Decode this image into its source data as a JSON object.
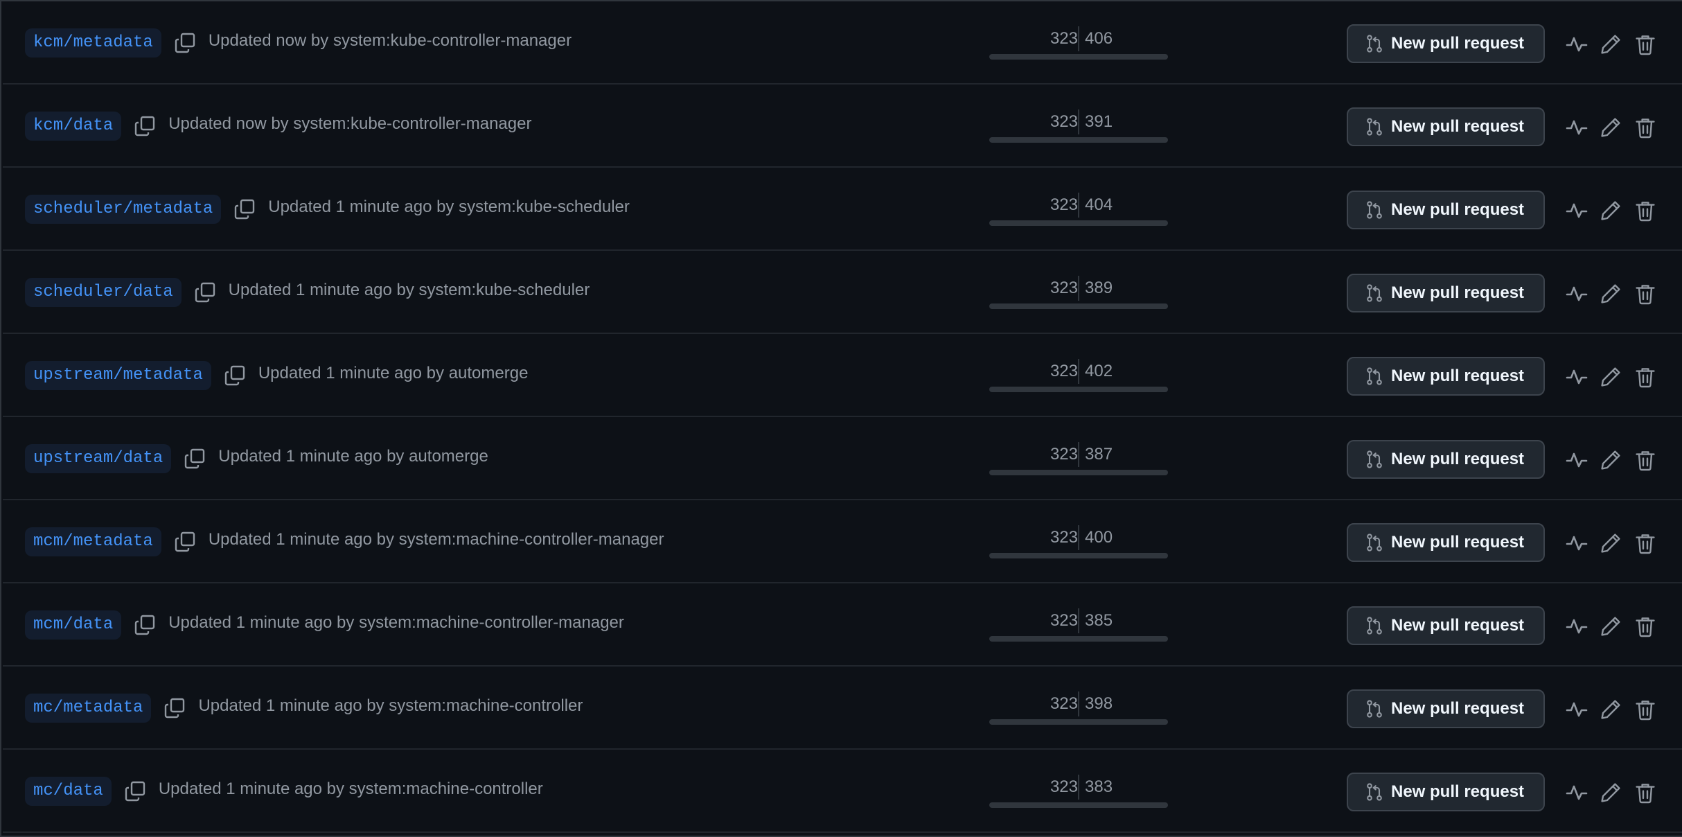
{
  "branches": [
    {
      "name": "kcm/metadata",
      "updated": "Updated now by system:kube-controller-manager",
      "behind": "323",
      "ahead": "406",
      "pr_label": "New pull request"
    },
    {
      "name": "kcm/data",
      "updated": "Updated now by system:kube-controller-manager",
      "behind": "323",
      "ahead": "391",
      "pr_label": "New pull request"
    },
    {
      "name": "scheduler/metadata",
      "updated": "Updated 1 minute ago by system:kube-scheduler",
      "behind": "323",
      "ahead": "404",
      "pr_label": "New pull request"
    },
    {
      "name": "scheduler/data",
      "updated": "Updated 1 minute ago by system:kube-scheduler",
      "behind": "323",
      "ahead": "389",
      "pr_label": "New pull request"
    },
    {
      "name": "upstream/metadata",
      "updated": "Updated 1 minute ago by automerge",
      "behind": "323",
      "ahead": "402",
      "pr_label": "New pull request"
    },
    {
      "name": "upstream/data",
      "updated": "Updated 1 minute ago by automerge",
      "behind": "323",
      "ahead": "387",
      "pr_label": "New pull request"
    },
    {
      "name": "mcm/metadata",
      "updated": "Updated 1 minute ago by system:machine-controller-manager",
      "behind": "323",
      "ahead": "400",
      "pr_label": "New pull request"
    },
    {
      "name": "mcm/data",
      "updated": "Updated 1 minute ago by system:machine-controller-manager",
      "behind": "323",
      "ahead": "385",
      "pr_label": "New pull request"
    },
    {
      "name": "mc/metadata",
      "updated": "Updated 1 minute ago by system:machine-controller",
      "behind": "323",
      "ahead": "398",
      "pr_label": "New pull request"
    },
    {
      "name": "mc/data",
      "updated": "Updated 1 minute ago by system:machine-controller",
      "behind": "323",
      "ahead": "383",
      "pr_label": "New pull request"
    }
  ],
  "icons": {
    "copy": "copy-icon",
    "pull_request": "git-pull-request-icon",
    "activity": "pulse-icon",
    "edit": "pencil-icon",
    "delete": "trash-icon"
  },
  "colors": {
    "background": "#0d1117",
    "branch_text": "#4493f8",
    "branch_bg": "#131d2e",
    "muted_text": "#9198a1",
    "button_bg": "#212830",
    "button_border": "#3d444d",
    "button_text": "#f0f6fc",
    "divider": "#21262d"
  }
}
